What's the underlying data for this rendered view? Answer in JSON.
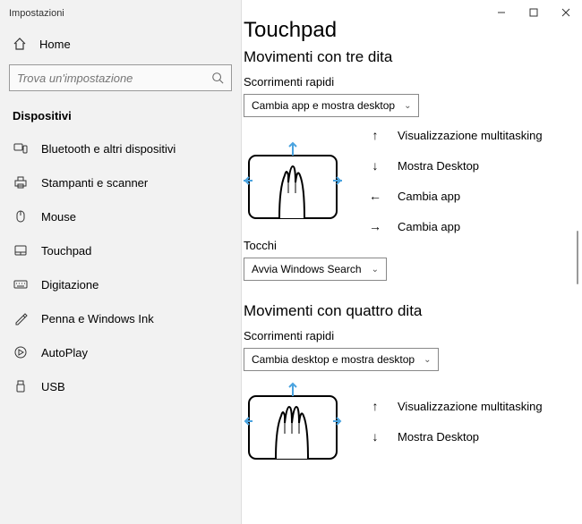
{
  "window": {
    "title": "Impostazioni"
  },
  "sidebar": {
    "home": "Home",
    "search_placeholder": "Trova un'impostazione",
    "category": "Dispositivi",
    "items": [
      {
        "label": "Bluetooth e altri dispositivi"
      },
      {
        "label": "Stampanti e scanner"
      },
      {
        "label": "Mouse"
      },
      {
        "label": "Touchpad"
      },
      {
        "label": "Digitazione"
      },
      {
        "label": "Penna e Windows Ink"
      },
      {
        "label": "AutoPlay"
      },
      {
        "label": "USB"
      }
    ]
  },
  "main": {
    "title": "Touchpad",
    "three": {
      "heading": "Movimenti con tre dita",
      "swipes_label": "Scorrimenti rapidi",
      "swipes_value": "Cambia app e mostra desktop",
      "gestures": [
        {
          "dir": "up",
          "label": "Visualizzazione multitasking"
        },
        {
          "dir": "down",
          "label": "Mostra Desktop"
        },
        {
          "dir": "left",
          "label": "Cambia app"
        },
        {
          "dir": "right",
          "label": "Cambia app"
        }
      ],
      "taps_label": "Tocchi",
      "taps_value": "Avvia Windows Search"
    },
    "four": {
      "heading": "Movimenti con quattro dita",
      "swipes_label": "Scorrimenti rapidi",
      "swipes_value": "Cambia desktop e mostra desktop",
      "gestures": [
        {
          "dir": "up",
          "label": "Visualizzazione multitasking"
        },
        {
          "dir": "down",
          "label": "Mostra Desktop"
        }
      ]
    }
  }
}
